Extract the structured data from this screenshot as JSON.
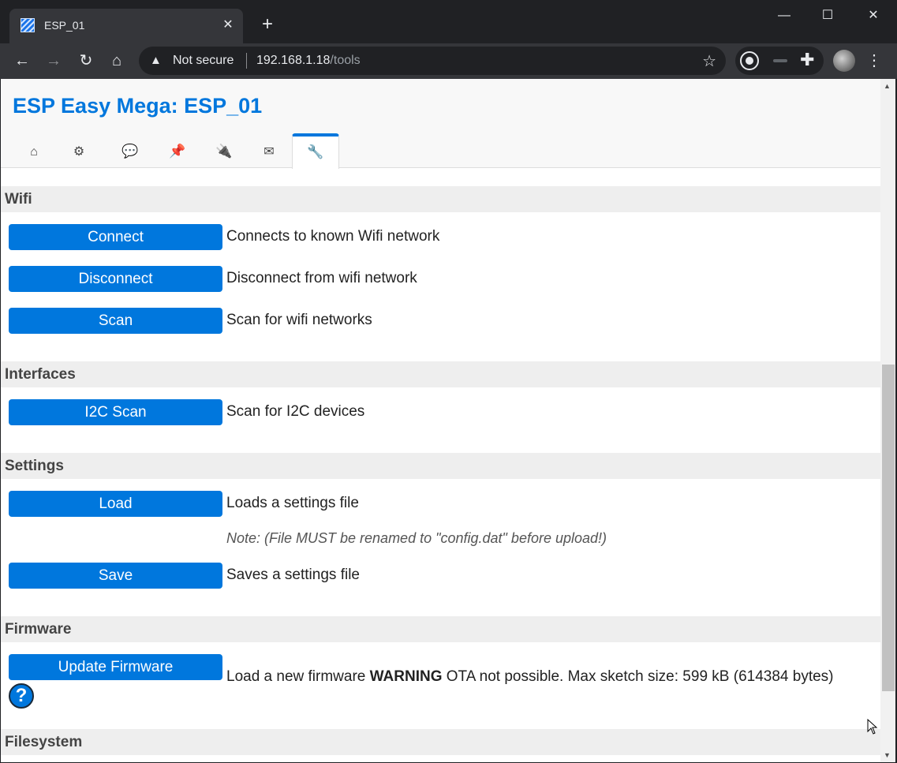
{
  "browser": {
    "tab_title": "ESP_01",
    "tab_close": "✕",
    "new_tab": "+",
    "window_minimize": "—",
    "window_maximize": "☐",
    "window_close": "✕",
    "security_icon": "▲",
    "security_label": "Not secure",
    "url_host": "192.168.1.18",
    "url_path": "/tools",
    "back": "←",
    "forward": "→",
    "reload": "↻",
    "home": "⌂",
    "bookmark": "☆",
    "extensions": "✚",
    "menu": "⋮",
    "icons": [
      "favicon-icon",
      "back-arrow-icon",
      "forward-arrow-icon",
      "reload-icon",
      "home-icon",
      "warning-icon",
      "star-icon",
      "extension-icon",
      "puzzle-icon",
      "avatar-icon",
      "kebab-menu-icon"
    ]
  },
  "page": {
    "title": "ESP Easy Mega: ESP_01",
    "menu_tabs": [
      {
        "name": "main-tab",
        "icon": "⌂"
      },
      {
        "name": "config-tab",
        "icon": "⚙"
      },
      {
        "name": "controllers-tab",
        "icon": "💬"
      },
      {
        "name": "hardware-tab",
        "icon": "📌"
      },
      {
        "name": "devices-tab",
        "icon": "🔌"
      },
      {
        "name": "notifications-tab",
        "icon": "✉"
      },
      {
        "name": "tools-tab",
        "icon": "🔧"
      }
    ],
    "sections": {
      "wifi": "Wifi",
      "interfaces": "Interfaces",
      "settings": "Settings",
      "firmware": "Firmware",
      "filesystem": "Filesystem"
    },
    "buttons": {
      "connect": {
        "label": "Connect",
        "desc": "Connects to known Wifi network"
      },
      "disconnect": {
        "label": "Disconnect",
        "desc": "Disconnect from wifi network"
      },
      "scan": {
        "label": "Scan",
        "desc": "Scan for wifi networks"
      },
      "i2c_scan": {
        "label": "I2C Scan",
        "desc": "Scan for I2C devices"
      },
      "load": {
        "label": "Load",
        "desc": "Loads a settings file",
        "note": "Note: (File MUST be renamed to \"config.dat\" before upload!)"
      },
      "save": {
        "label": "Save",
        "desc": "Saves a settings file"
      },
      "update_firmware": {
        "label": "Update Firmware",
        "desc_pre": "Load a new firmware ",
        "desc_warning": "WARNING",
        "desc_post": " OTA not possible. Max sketch size: 599 kB (614384 bytes)",
        "help": "?"
      }
    }
  },
  "colors": {
    "accent": "#0077dd",
    "section_bg": "#eeeeee",
    "chrome_dark": "#202124",
    "chrome_toolbar": "#35363a"
  },
  "scrollbar": {
    "position_fraction": 0.64
  }
}
